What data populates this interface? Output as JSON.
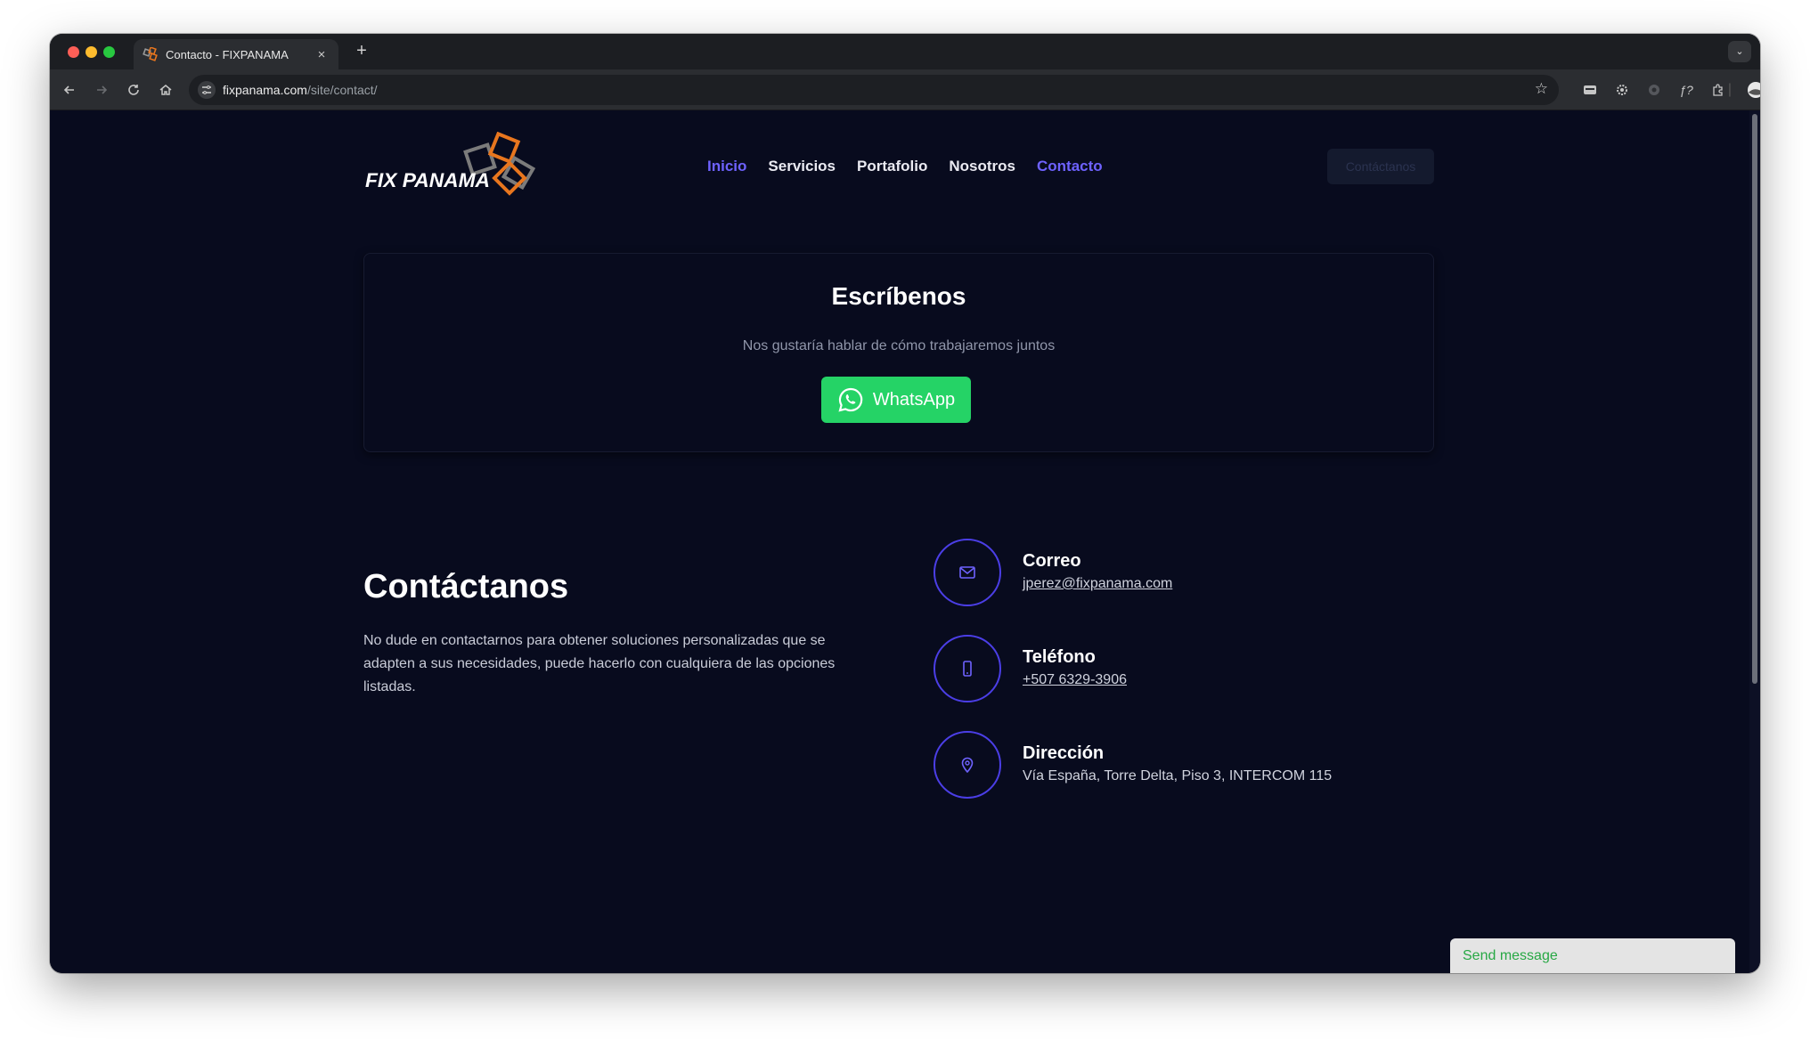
{
  "browser": {
    "tab_title": "Contacto - FIXPANAMA",
    "tab_close": "×",
    "new_tab": "+",
    "url_host": "fixpanama.com",
    "url_path": "/site/contact/"
  },
  "header": {
    "logo_alt": "FIX PANAMA",
    "nav": {
      "inicio": "Inicio",
      "servicios": "Servicios",
      "portafolio": "Portafolio",
      "nosotros": "Nosotros",
      "contacto": "Contacto"
    },
    "cta_label": "Contáctanos"
  },
  "write_card": {
    "title": "Escríbenos",
    "subtitle": "Nos gustaría hablar de cómo trabajaremos juntos",
    "whatsapp_label": "WhatsApp"
  },
  "contact": {
    "title": "Contáctanos",
    "description": "No dude en contactarnos para obtener soluciones personalizadas que se adapten a sus necesidades, puede hacerlo con cualquiera de las opciones listadas.",
    "email": {
      "label": "Correo",
      "value": "jperez@fixpanama.com",
      "icon": "mail-icon"
    },
    "phone": {
      "label": "Teléfono",
      "value": "+507 6329-3906",
      "icon": "phone-icon"
    },
    "address": {
      "label": "Dirección",
      "value": "Vía España, Torre Delta, Piso 3, INTERCOM 115",
      "icon": "map-pin-icon"
    }
  },
  "chat_widget": {
    "label": "Send message"
  },
  "colors": {
    "background": "#080b1e",
    "accent": "#6e62ff",
    "circle_border": "#4b3ee6",
    "whatsapp_green": "#25d366",
    "logo_orange": "#e8761e"
  }
}
